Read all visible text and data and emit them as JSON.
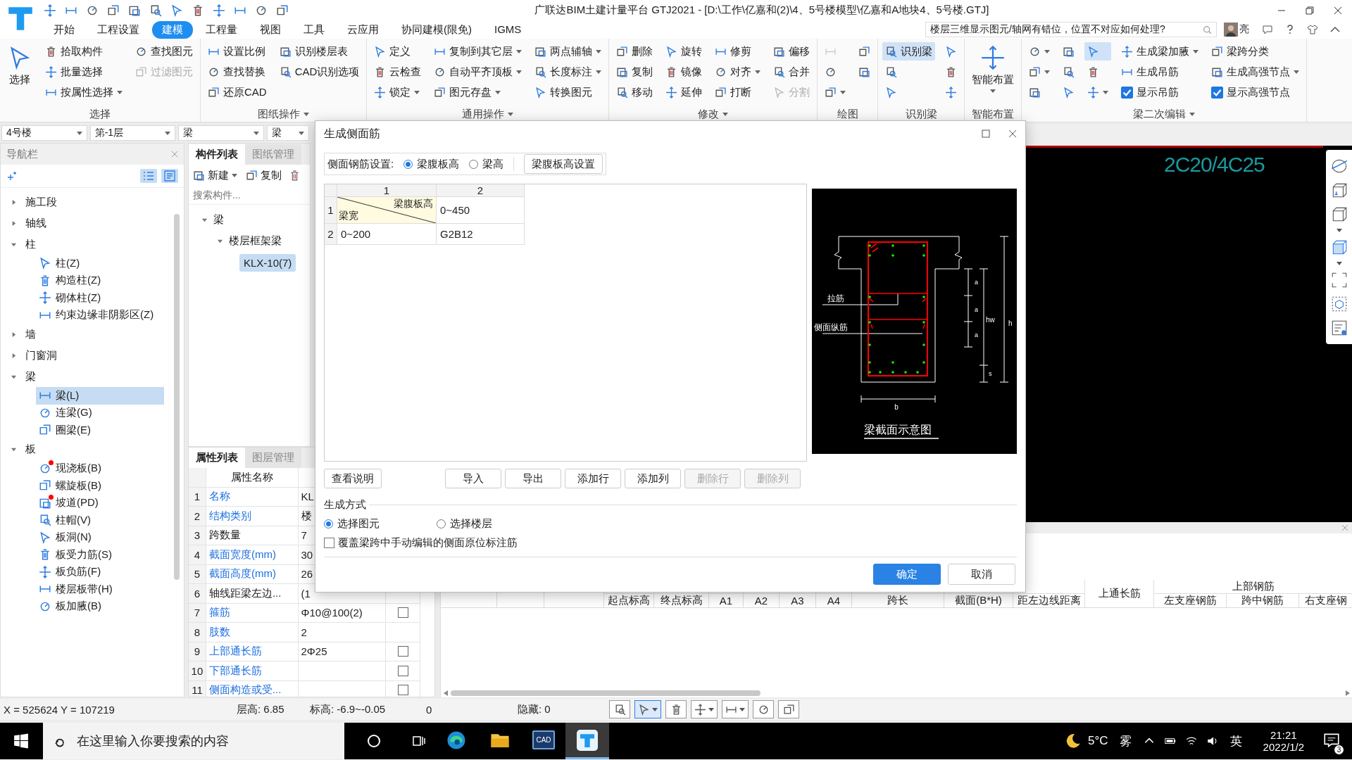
{
  "title_bar": {
    "title": "广联达BIM土建计量平台 GTJ2021 - [D:\\工作\\亿嘉和(2)\\4、5号楼模型\\亿嘉和A地块4、5号楼.GTJ]",
    "help_search": {
      "value": "楼层三维显示图元/轴网有错位，位置不对应如何处理?"
    },
    "user": "亮"
  },
  "menu_tabs": [
    {
      "label": "开始",
      "selected": false
    },
    {
      "label": "工程设置",
      "selected": false
    },
    {
      "label": "建模",
      "selected": true
    },
    {
      "label": "工程量",
      "selected": false
    },
    {
      "label": "视图",
      "selected": false
    },
    {
      "label": "工具",
      "selected": false
    },
    {
      "label": "云应用",
      "selected": false
    },
    {
      "label": "协同建模(限免)",
      "selected": false
    },
    {
      "label": "IGMS",
      "selected": false
    }
  ],
  "ribbon": {
    "groups": [
      {
        "label": "选择",
        "dropdown": false,
        "columns": [
          [
            {
              "kind": "large",
              "label": "选择",
              "dropdown": false,
              "disabled": false,
              "selected": false
            }
          ],
          [
            {
              "kind": "small",
              "label": "拾取构件",
              "dropdown": false,
              "disabled": false,
              "selected": false
            },
            {
              "kind": "small",
              "label": "批量选择",
              "dropdown": false,
              "disabled": false,
              "selected": false
            },
            {
              "kind": "small",
              "label": "按属性选择",
              "dropdown": true,
              "disabled": false,
              "selected": false
            }
          ],
          [
            {
              "kind": "small",
              "label": "查找图元",
              "dropdown": false,
              "disabled": false,
              "selected": false
            },
            {
              "kind": "small",
              "label": "过滤图元",
              "dropdown": false,
              "disabled": true,
              "selected": false
            }
          ]
        ]
      },
      {
        "label": "图纸操作",
        "dropdown": true,
        "columns": [
          [
            {
              "kind": "small",
              "label": "设置比例",
              "dropdown": false,
              "disabled": false,
              "selected": false
            },
            {
              "kind": "small",
              "label": "查找替换",
              "dropdown": false,
              "disabled": false,
              "selected": false
            },
            {
              "kind": "small",
              "label": "还原CAD",
              "dropdown": false,
              "disabled": false,
              "selected": false
            }
          ],
          [
            {
              "kind": "small",
              "label": "识别楼层表",
              "dropdown": false,
              "disabled": false,
              "selected": false
            },
            {
              "kind": "small",
              "label": "CAD识别选项",
              "dropdown": false,
              "disabled": false,
              "selected": false
            }
          ]
        ]
      },
      {
        "label": "通用操作",
        "dropdown": true,
        "columns": [
          [
            {
              "kind": "small",
              "label": "定义",
              "dropdown": false,
              "disabled": false,
              "selected": false
            },
            {
              "kind": "small",
              "label": "云检查",
              "dropdown": false,
              "disabled": false,
              "selected": false
            },
            {
              "kind": "small",
              "label": "锁定",
              "dropdown": true,
              "disabled": false,
              "selected": false
            }
          ],
          [
            {
              "kind": "small",
              "label": "复制到其它层",
              "dropdown": true,
              "disabled": false,
              "selected": false
            },
            {
              "kind": "small",
              "label": "自动平齐顶板",
              "dropdown": true,
              "disabled": false,
              "selected": false
            },
            {
              "kind": "small",
              "label": "图元存盘",
              "dropdown": true,
              "disabled": false,
              "selected": false
            }
          ],
          [
            {
              "kind": "small",
              "label": "两点辅轴",
              "dropdown": true,
              "disabled": false,
              "selected": false
            },
            {
              "kind": "small",
              "label": "长度标注",
              "dropdown": true,
              "disabled": false,
              "selected": false
            },
            {
              "kind": "small",
              "label": "转换图元",
              "dropdown": false,
              "disabled": false,
              "selected": false
            }
          ]
        ]
      },
      {
        "label": "修改",
        "dropdown": true,
        "columns": [
          [
            {
              "kind": "small",
              "label": "删除",
              "dropdown": false,
              "disabled": false,
              "selected": false
            },
            {
              "kind": "small",
              "label": "复制",
              "dropdown": false,
              "disabled": false,
              "selected": false
            },
            {
              "kind": "small",
              "label": "移动",
              "dropdown": false,
              "disabled": false,
              "selected": false
            }
          ],
          [
            {
              "kind": "small",
              "label": "旋转",
              "dropdown": false,
              "disabled": false,
              "selected": false
            },
            {
              "kind": "small",
              "label": "镜像",
              "dropdown": false,
              "disabled": false,
              "selected": false
            },
            {
              "kind": "small",
              "label": "延伸",
              "dropdown": false,
              "disabled": false,
              "selected": false
            }
          ],
          [
            {
              "kind": "small",
              "label": "修剪",
              "dropdown": false,
              "disabled": false,
              "selected": false
            },
            {
              "kind": "small",
              "label": "对齐",
              "dropdown": true,
              "disabled": false,
              "selected": false
            },
            {
              "kind": "small",
              "label": "打断",
              "dropdown": false,
              "disabled": false,
              "selected": false
            }
          ],
          [
            {
              "kind": "small",
              "label": "偏移",
              "dropdown": false,
              "disabled": false,
              "selected": false
            },
            {
              "kind": "small",
              "label": "合并",
              "dropdown": false,
              "disabled": false,
              "selected": false
            },
            {
              "kind": "small",
              "label": "分割",
              "dropdown": false,
              "disabled": true,
              "selected": false
            }
          ]
        ]
      },
      {
        "label": "绘图",
        "dropdown": false,
        "columns": [
          [
            {
              "kind": "icon",
              "dropdown": false,
              "disabled": true,
              "selected": false
            },
            {
              "kind": "icon",
              "dropdown": false,
              "disabled": false,
              "selected": false
            },
            {
              "kind": "icon",
              "dropdown": true,
              "disabled": false,
              "selected": false
            }
          ],
          [
            {
              "kind": "icon",
              "dropdown": false,
              "disabled": false,
              "selected": false
            },
            {
              "kind": "icon",
              "dropdown": false,
              "disabled": false,
              "selected": false
            }
          ]
        ]
      },
      {
        "label": "识别梁",
        "dropdown": false,
        "columns": [
          [
            {
              "kind": "small",
              "label": "识别梁",
              "dropdown": false,
              "disabled": false,
              "selected": true
            },
            {
              "kind": "icon",
              "dropdown": false,
              "disabled": false,
              "selected": false
            },
            {
              "kind": "icon",
              "dropdown": false,
              "disabled": false,
              "selected": false
            }
          ],
          [
            {
              "kind": "icon",
              "dropdown": false,
              "disabled": false,
              "selected": false
            },
            {
              "kind": "icon",
              "dropdown": false,
              "disabled": false,
              "selected": false
            },
            {
              "kind": "icon",
              "dropdown": false,
              "disabled": false,
              "selected": false
            }
          ]
        ]
      },
      {
        "label": "智能布置",
        "dropdown": false,
        "columns": [
          [
            {
              "kind": "large",
              "label": "智能布置",
              "dropdown": true,
              "disabled": false,
              "selected": false
            }
          ]
        ]
      },
      {
        "label": "梁二次编辑",
        "dropdown": true,
        "columns": [
          [
            {
              "kind": "icon",
              "dropdown": true,
              "disabled": false,
              "selected": false
            },
            {
              "kind": "icon",
              "dropdown": true,
              "disabled": false,
              "selected": false
            },
            {
              "kind": "icon",
              "dropdown": false,
              "disabled": false,
              "selected": false
            }
          ],
          [
            {
              "kind": "icon",
              "dropdown": false,
              "disabled": false,
              "selected": false
            },
            {
              "kind": "icon",
              "dropdown": false,
              "disabled": false,
              "selected": false
            },
            {
              "kind": "icon",
              "dropdown": false,
              "disabled": false,
              "selected": false
            }
          ],
          [
            {
              "kind": "icon",
              "dropdown": false,
              "disabled": false,
              "selected": true
            },
            {
              "kind": "icon",
              "dropdown": false,
              "disabled": false,
              "selected": false
            },
            {
              "kind": "icon",
              "dropdown": true,
              "disabled": false,
              "selected": false
            }
          ],
          [
            {
              "kind": "small",
              "label": "生成梁加腋",
              "dropdown": true,
              "disabled": false,
              "selected": false
            },
            {
              "kind": "small",
              "label": "生成吊筋",
              "dropdown": false,
              "disabled": false,
              "selected": false
            },
            {
              "kind": "check",
              "label": "显示吊筋",
              "checked": true
            }
          ],
          [
            {
              "kind": "small",
              "label": "梁跨分类",
              "dropdown": false,
              "disabled": false,
              "selected": false
            },
            {
              "kind": "small",
              "label": "生成高强节点",
              "dropdown": true,
              "disabled": false,
              "selected": false
            },
            {
              "kind": "check",
              "label": "显示高强节点",
              "checked": true
            }
          ]
        ]
      }
    ]
  },
  "selectors": [
    {
      "value": "4号楼"
    },
    {
      "value": "第-1层"
    },
    {
      "value": "梁"
    },
    {
      "value": "梁"
    }
  ],
  "navigator": {
    "title": "导航栏",
    "tree": [
      {
        "label": "施工段",
        "expanded": false
      },
      {
        "label": "轴线",
        "expanded": false
      },
      {
        "label": "柱",
        "expanded": true,
        "children": [
          {
            "label": "柱(Z)",
            "selected": false,
            "flagged": false
          },
          {
            "label": "构造柱(Z)",
            "selected": false,
            "flagged": false
          },
          {
            "label": "砌体柱(Z)",
            "selected": false,
            "flagged": false
          },
          {
            "label": "约束边缘非阴影区(Z)",
            "selected": false,
            "flagged": false
          }
        ]
      },
      {
        "label": "墙",
        "expanded": false
      },
      {
        "label": "门窗洞",
        "expanded": false
      },
      {
        "label": "梁",
        "expanded": true,
        "children": [
          {
            "label": "梁(L)",
            "selected": true,
            "flagged": false
          },
          {
            "label": "连梁(G)",
            "selected": false,
            "flagged": false
          },
          {
            "label": "圈梁(E)",
            "selected": false,
            "flagged": false
          }
        ]
      },
      {
        "label": "板",
        "expanded": true,
        "children": [
          {
            "label": "现浇板(B)",
            "selected": false,
            "flagged": true
          },
          {
            "label": "螺旋板(B)",
            "selected": false,
            "flagged": false
          },
          {
            "label": "坡道(PD)",
            "selected": false,
            "flagged": true
          },
          {
            "label": "柱帽(V)",
            "selected": false,
            "flagged": false
          },
          {
            "label": "板洞(N)",
            "selected": false,
            "flagged": false
          },
          {
            "label": "板受力筋(S)",
            "selected": false,
            "flagged": false
          },
          {
            "label": "板负筋(F)",
            "selected": false,
            "flagged": false
          },
          {
            "label": "楼层板带(H)",
            "selected": false,
            "flagged": false
          },
          {
            "label": "板加腋(B)",
            "selected": false,
            "flagged": false
          }
        ]
      }
    ]
  },
  "component_panel": {
    "tabs": [
      {
        "label": "构件列表",
        "selected": true
      },
      {
        "label": "图纸管理",
        "selected": false
      }
    ],
    "toolbar": [
      {
        "label": "新建",
        "dropdown": true
      },
      {
        "label": "复制",
        "dropdown": false
      }
    ],
    "search": {
      "placeholder": "搜索构件..."
    },
    "tree": [
      {
        "label": "梁",
        "expanded": true,
        "children": [
          {
            "label": "楼层框架梁",
            "expanded": true,
            "children": [
              {
                "label": "KLX-10(7)",
                "selected": true
              }
            ]
          }
        ]
      }
    ]
  },
  "property_panel": {
    "tabs": [
      {
        "label": "属性列表",
        "selected": true
      },
      {
        "label": "图层管理",
        "selected": false
      }
    ],
    "header": "属性名称",
    "rows": [
      {
        "index": "1",
        "name": "名称",
        "link": true,
        "value": "KL",
        "kind": "plain"
      },
      {
        "index": "2",
        "name": "结构类别",
        "link": true,
        "value": "楼",
        "kind": "plain"
      },
      {
        "index": "3",
        "name": "跨数量",
        "link": false,
        "value": "7",
        "kind": "plain"
      },
      {
        "index": "4",
        "name": "截面宽度(mm)",
        "link": true,
        "value": "30",
        "kind": "plain"
      },
      {
        "index": "5",
        "name": "截面高度(mm)",
        "link": true,
        "value": "26",
        "kind": "plain"
      },
      {
        "index": "6",
        "name": "轴线距梁左边...",
        "link": false,
        "value": "(1",
        "kind": "plain"
      },
      {
        "index": "7",
        "name": "箍筋",
        "link": true,
        "value": "Φ10@100(2)",
        "kind": "check",
        "checked": false
      },
      {
        "index": "8",
        "name": "肢数",
        "link": true,
        "value": "2",
        "kind": "plain"
      },
      {
        "index": "9",
        "name": "上部通长筋",
        "link": true,
        "value": "2Φ25",
        "kind": "check",
        "checked": false
      },
      {
        "index": "10",
        "name": "下部通长筋",
        "link": true,
        "kind": "check",
        "checked": false
      },
      {
        "index": "11",
        "name": "侧面构造或受...",
        "link": true,
        "kind": "check",
        "checked": false
      }
    ]
  },
  "canvas": {
    "annotation": "2C20/4C25"
  },
  "detail_table": {
    "columns": [
      {
        "label": "起点标高",
        "kind": "low"
      },
      {
        "label": "终点标高",
        "kind": "low"
      },
      {
        "label": "A1",
        "kind": "low"
      },
      {
        "label": "A2",
        "kind": "low"
      },
      {
        "label": "A3",
        "kind": "low"
      },
      {
        "label": "A4",
        "kind": "low"
      },
      {
        "label": "跨长",
        "kind": "low"
      },
      {
        "label": "截面(B*H)",
        "kind": "low"
      },
      {
        "label": "距左边线距离",
        "kind": "low"
      },
      {
        "label": "上通长筋",
        "kind": "tall"
      }
    ],
    "group": {
      "label": "上部钢筋",
      "columns": [
        "左支座钢筋",
        "跨中钢筋",
        "右支座钢"
      ]
    }
  },
  "status_bar": {
    "coordinates": "X = 525624 Y = 107219",
    "floor_height": "层高: 6.85",
    "elevation": "标高: -6.9~-0.05",
    "count": "0",
    "hidden": "隐藏: 0",
    "tools": [
      {
        "selected": false,
        "dropdown": false
      },
      {
        "selected": true,
        "dropdown": true
      },
      {
        "selected": false,
        "dropdown": false
      },
      {
        "selected": false,
        "dropdown": true
      },
      {
        "selected": false,
        "dropdown": true
      },
      {
        "selected": false,
        "dropdown": false
      },
      {
        "selected": false,
        "dropdown": false
      }
    ]
  },
  "dialog": {
    "title": "生成侧面筋",
    "setting_label": "侧面钢筋设置:",
    "setting_options": [
      {
        "label": "梁腹板高",
        "selected": true
      },
      {
        "label": "梁高",
        "selected": false
      }
    ],
    "setting_button": "梁腹板高设置",
    "grid": {
      "column_headers": [
        "1",
        "2"
      ],
      "rows": [
        {
          "header": "1",
          "cells": [
            {
              "kind": "diagonal",
              "top": "梁腹板高",
              "bottom": "梁宽"
            },
            {
              "kind": "text",
              "text": "0~450"
            }
          ]
        },
        {
          "header": "2",
          "cells": [
            {
              "kind": "text",
              "text": "0~200"
            },
            {
              "kind": "text",
              "text": "G2B12"
            }
          ]
        }
      ]
    },
    "diagram": {
      "labels": [
        "拉筋",
        "侧面纵筋",
        "a",
        "a",
        "a",
        "hw",
        "h",
        "s",
        "b"
      ],
      "caption": "梁截面示意图"
    },
    "help_button": "查看说明",
    "buttons": [
      {
        "label": "导入",
        "disabled": false
      },
      {
        "label": "导出",
        "disabled": false
      },
      {
        "label": "添加行",
        "disabled": false
      },
      {
        "label": "添加列",
        "disabled": false
      },
      {
        "label": "删除行",
        "disabled": true
      },
      {
        "label": "删除列",
        "disabled": true
      }
    ],
    "mode": {
      "title": "生成方式",
      "options": [
        {
          "label": "选择图元",
          "selected": true
        },
        {
          "label": "选择楼层",
          "selected": false
        }
      ],
      "override": {
        "label": "覆盖梁跨中手动编辑的侧面原位标注筋",
        "checked": false
      }
    },
    "footer": [
      {
        "label": "确定",
        "primary": true
      },
      {
        "label": "取消",
        "primary": false
      }
    ]
  },
  "taskbar": {
    "search": {
      "placeholder": "在这里输入你要搜索的内容"
    },
    "apps": [
      {
        "kind": "edge",
        "active": false
      },
      {
        "kind": "folder",
        "active": false
      },
      {
        "kind": "cad",
        "label": "CAD",
        "active": false
      },
      {
        "kind": "gtj",
        "active": true
      }
    ],
    "temperature": "5°C",
    "weather": "雾",
    "ime": "英",
    "time": "21:21",
    "date": "2022/1/2",
    "notifications": "3"
  }
}
